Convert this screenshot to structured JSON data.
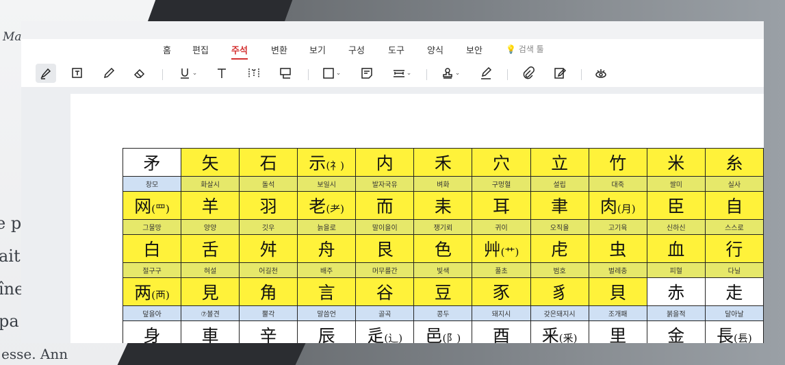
{
  "background_text": [
    "Ma",
    "e pr",
    "ait",
    "îne",
    "pa",
    "esse. Ann"
  ],
  "menu": {
    "items": [
      "홈",
      "편집",
      "주석",
      "변환",
      "보기",
      "구성",
      "도구",
      "양식",
      "보안"
    ],
    "active": "주석",
    "search_hint": "검색 툴"
  },
  "toolbar": {
    "tools": [
      {
        "name": "highlight-icon",
        "selected": true
      },
      {
        "name": "text-box-icon"
      },
      {
        "name": "pencil-icon"
      },
      {
        "name": "eraser-icon"
      },
      {
        "name": "underline-icon",
        "dropdown": true
      },
      {
        "name": "text-icon"
      },
      {
        "name": "text-field-icon"
      },
      {
        "name": "callout-icon"
      },
      {
        "name": "rectangle-icon",
        "dropdown": true
      },
      {
        "name": "note-icon"
      },
      {
        "name": "measure-icon",
        "dropdown": true
      },
      {
        "name": "stamp-icon",
        "dropdown": true
      },
      {
        "name": "signature-icon"
      },
      {
        "name": "attachment-icon"
      },
      {
        "name": "edit-note-icon"
      },
      {
        "name": "view-icon"
      }
    ]
  },
  "table": {
    "rows": [
      {
        "chars": [
          "矛",
          "矢",
          "石",
          "示(礻)",
          "内",
          "禾",
          "穴",
          "立",
          "竹",
          "米",
          "糸"
        ],
        "glosses": [
          "창모",
          "화살시",
          "돌석",
          "보일시",
          "발자국유",
          "벼화",
          "구멍혈",
          "설립",
          "대죽",
          "쌀미",
          "실사"
        ],
        "highlight": [
          false,
          true,
          true,
          true,
          true,
          true,
          true,
          true,
          true,
          true,
          true
        ]
      },
      {
        "chars": [
          "网(罒)",
          "羊",
          "羽",
          "老(耂)",
          "而",
          "耒",
          "耳",
          "聿",
          "肉(月)",
          "臣",
          "自"
        ],
        "glosses": [
          "그물망",
          "양양",
          "깃우",
          "늙을로",
          "말이을이",
          "쟁기뢰",
          "귀이",
          "오직율",
          "고기육",
          "신하신",
          "스스로"
        ],
        "highlight": [
          true,
          true,
          true,
          true,
          true,
          true,
          true,
          true,
          true,
          true,
          true
        ]
      },
      {
        "chars": [
          "白",
          "舌",
          "舛",
          "舟",
          "艮",
          "色",
          "艸(艹)",
          "虍",
          "虫",
          "血",
          "行"
        ],
        "glosses": [
          "절구구",
          "혀설",
          "어길천",
          "배주",
          "머무를간",
          "빛색",
          "풀초",
          "범호",
          "벌레충",
          "피혈",
          "다닐"
        ],
        "highlight": [
          true,
          true,
          true,
          true,
          true,
          true,
          true,
          true,
          true,
          true,
          true
        ]
      },
      {
        "chars": [
          "两(襾)",
          "見",
          "角",
          "言",
          "谷",
          "豆",
          "豕",
          "豸",
          "貝",
          "赤",
          "走"
        ],
        "glosses": [
          "덮을아",
          "⑦볼견",
          "뿔각",
          "말씀언",
          "골곡",
          "콩두",
          "돼지시",
          "갖은돼지시",
          "조개패",
          "붉을적",
          "달아날"
        ],
        "highlight": [
          true,
          true,
          true,
          true,
          true,
          true,
          true,
          true,
          true,
          false,
          false
        ]
      },
      {
        "chars": [
          "身",
          "車",
          "辛",
          "辰",
          "辵(辶)",
          "邑(阝)",
          "酉",
          "釆(釆)",
          "里",
          "金",
          "長(镸)"
        ],
        "glosses": [],
        "highlight": [
          false,
          false,
          false,
          false,
          false,
          false,
          false,
          false,
          false,
          false,
          false
        ]
      }
    ]
  }
}
